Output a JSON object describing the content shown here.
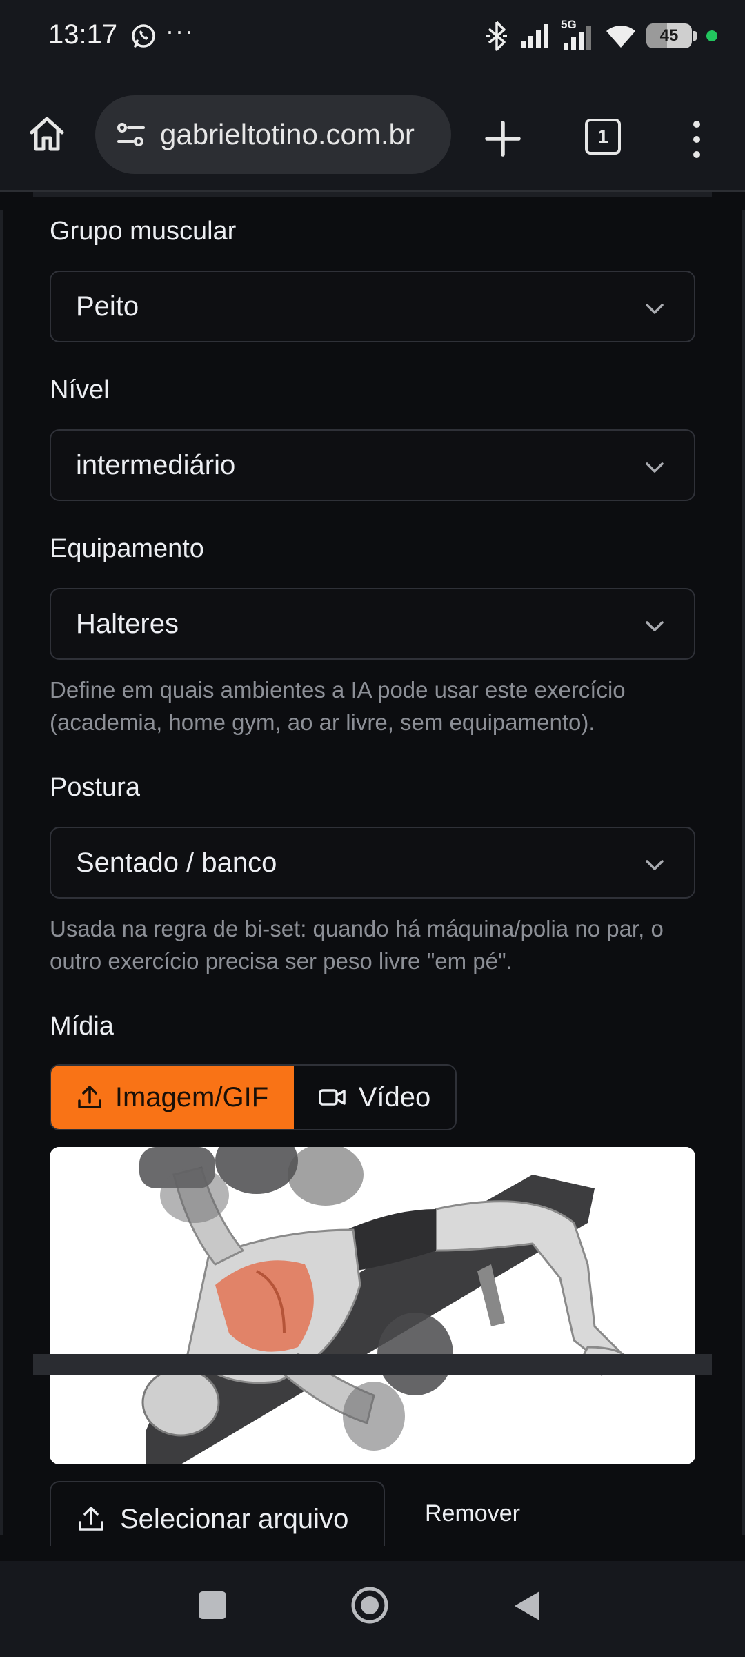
{
  "status_bar": {
    "time": "13:17",
    "battery_level": "45",
    "more": "···",
    "network": "5G"
  },
  "browser": {
    "url": "gabrieltotino.com.br",
    "tab_count": "1"
  },
  "form": {
    "muscle_group": {
      "label": "Grupo muscular",
      "value": "Peito"
    },
    "level": {
      "label": "Nível",
      "value": "intermediário"
    },
    "equipment": {
      "label": "Equipamento",
      "value": "Halteres",
      "helper": "Define em quais ambientes a IA pode usar este exercício (academia, home gym, ao ar livre, sem equipamento)."
    },
    "posture": {
      "label": "Postura",
      "value": "Sentado / banco",
      "helper": "Usada na regra de bi-set: quando há máquina/polia no par, o outro exercício precisa ser peso livre \"em pé\"."
    },
    "media": {
      "label": "Mídia",
      "tab_image": "Imagem/GIF",
      "tab_video": "Vídeo",
      "select_file": "Selecionar arquivo",
      "remove": "Remover"
    }
  },
  "colors": {
    "accent": "#f97316",
    "background": "#0c0d10",
    "bar": "#16181d"
  }
}
